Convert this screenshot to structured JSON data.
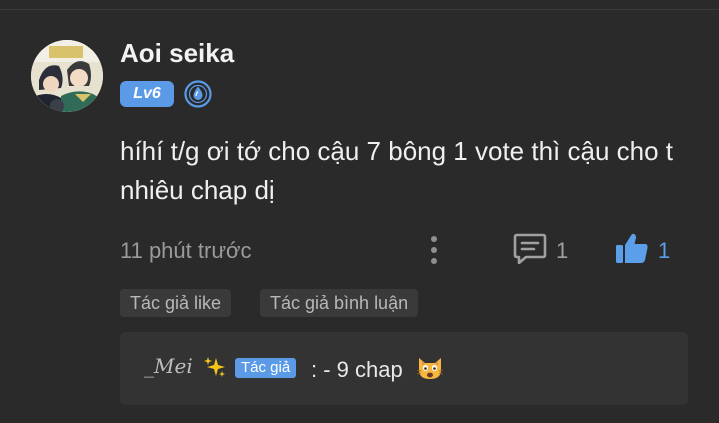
{
  "comment": {
    "username": "Aoi seika",
    "level": "Lv6",
    "text": "híhí t/g ơi tớ cho cậu 7 bông 1 vote thì cậu cho t nhiêu chap dị",
    "time": "11 phút trước",
    "reply_count": "1",
    "like_count": "1",
    "tags": [
      "Tác giả like",
      "Tác giả bình luận"
    ],
    "icons": {
      "avatar": "anime-avatar",
      "rank": "water-drop-rank-icon",
      "more": "vertical-dots-icon",
      "reply": "comment-bubble-icon",
      "like": "thumbs-up-icon"
    }
  },
  "reply": {
    "author_name": "_Mei",
    "author_badge": "Tác giả",
    "text": ": - 9 chap",
    "icons": {
      "sparkle": "sparkles-emoji",
      "cat": "weary-cat-emoji"
    }
  },
  "colors": {
    "background": "#2a2a2a",
    "accent": "#5a9ae6",
    "tag_bg": "#3a3a3a",
    "reply_bg": "#333333"
  }
}
